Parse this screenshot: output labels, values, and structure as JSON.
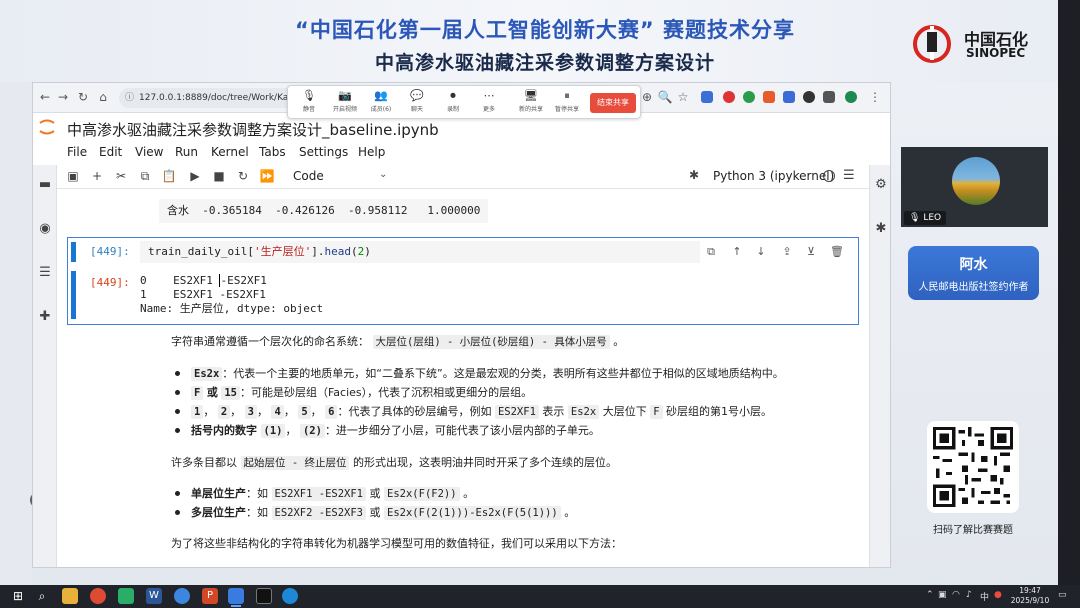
{
  "slide": {
    "title_line1": "“中国石化第一届人工智能创新大赛” 赛题技术分享",
    "title_line2": "中高渗水驱油藏注采参数调整方案设计",
    "logo_cn": "中国石化",
    "logo_en": "SINOPEC"
  },
  "browser": {
    "url": "127.0.0.1:8889/doc/tree/Work/Kaggle/",
    "meeting_toolbar": [
      {
        "icon": "microphone-icon",
        "glyph": "🎙",
        "label": "静音"
      },
      {
        "icon": "camera-icon",
        "glyph": "📷",
        "label": "开启视频"
      },
      {
        "icon": "members-icon",
        "glyph": "👥",
        "label": "成员(6)"
      },
      {
        "icon": "chat-icon",
        "glyph": "💬",
        "label": "聊天"
      },
      {
        "icon": "record-icon",
        "glyph": "⏺",
        "label": "录制"
      },
      {
        "icon": "more-icon",
        "glyph": "⋯",
        "label": "更多"
      },
      {
        "icon": "new-share-icon",
        "glyph": "🖥",
        "label": "新的共享"
      },
      {
        "icon": "pause-share-icon",
        "glyph": "⏸",
        "label": "暂停共享"
      }
    ],
    "end_share_label": "结束共享"
  },
  "notebook": {
    "title": "中高渗水驱油藏注采参数调整方案设计_baseline.ipynb",
    "menu": [
      "File",
      "Edit",
      "View",
      "Run",
      "Kernel",
      "Tabs",
      "Settings",
      "Help"
    ],
    "cell_type": "Code",
    "kernel_name": "Python 3 (ipykernel)",
    "prev_output": "含水  -0.365184  -0.426126  -0.958112   1.000000",
    "cell": {
      "in_prompt": "[449]:",
      "out_prompt": "[449]:",
      "code_var": "train_daily_oil[",
      "code_str": "'生产层位'",
      "code_mid": "].",
      "code_method": "head",
      "code_open": "(",
      "code_num": "2",
      "code_close": ")",
      "out_line1_a": "0    ES2XF1 ",
      "out_line1_b": "-ES2XF1",
      "out_line2": "1    ES2XF1 -ES2XF1",
      "out_line3": "Name: 生产层位, dtype: object"
    },
    "md": {
      "p1_text": "字符串通常遵循一个层次化的命名系统：",
      "p1_chip": "大层位(层组) - 小层位(砂层组) - 具体小层号",
      "p1_end": "。",
      "b1_chip": "Es2x",
      "b1_text": "：代表一个主要的地质单元，如“二叠系下统”。这是最宏观的分类，表明所有这些井都位于相似的区域地质结构中。",
      "b2_chip1": "F",
      "b2_or": "或",
      "b2_chip2": "15",
      "b2_text": "：可能是砂层组（Facies），代表了沉积相或更细分的层组。",
      "b3_chips": [
        "1",
        "2",
        "3",
        "4",
        "5",
        "6"
      ],
      "b3_text1": "：代表了具体的砂层编号，例如",
      "b3_chip_a": "ES2XF1",
      "b3_text2": "表示",
      "b3_chip_b": "Es2x",
      "b3_text3": "大层位下",
      "b3_chip_c": "F",
      "b3_text4": "砂层组的第1号小层。",
      "b4_bold": "括号内的数字",
      "b4_chip1": "(1)",
      "b4_chip2": "(2)",
      "b4_text": "：进一步细分了小层，可能代表了该小层内部的子单元。",
      "p2_text1": "许多条目都以",
      "p2_chip": "起始层位 - 终止层位",
      "p2_text2": "的形式出现，这表明油井同时开采了多个连续的层位。",
      "b5_bold": "单层位生产",
      "b5_text": "：如",
      "b5_chip1": "ES2XF1 -ES2XF1",
      "b5_or": "或",
      "b5_chip2": "Es2x(F(F2))",
      "b5_end": "。",
      "b6_bold": "多层位生产",
      "b6_text": "：如",
      "b6_chip1": "ES2XF2 -ES2XF3",
      "b6_or": "或",
      "b6_chip2": "Es2x(F(2(1)))-Es2x(F(5(1)))",
      "b6_end": "。",
      "p3_text": "为了将这些非结构化的字符串转化为机器学习模型可用的数值特征，我们可以采用以下方法："
    }
  },
  "side_panel": {
    "participant_name": "LEO",
    "speaker_name": "阿水",
    "speaker_title": "人民邮电出版社签约作者",
    "qr_caption": "扫码了解比赛赛题"
  },
  "taskbar": {
    "tray_ime": "中",
    "time": "19:47",
    "date": "2025/9/10"
  },
  "colors": {
    "title_blue": "#2b58b8",
    "accent_blue": "#1976d2",
    "end_share_red": "#e84c3d",
    "name_card_blue": "#3c78d8"
  }
}
